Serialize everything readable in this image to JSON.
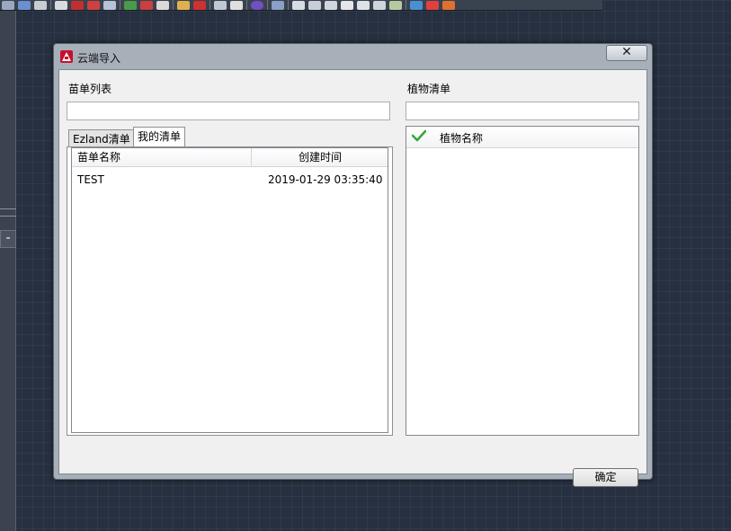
{
  "dialog": {
    "title": "云端导入",
    "close_label": "✕"
  },
  "left": {
    "section_label": "苗单列表",
    "search_value": "",
    "tabs": [
      {
        "label": "Ezland清单",
        "active": false
      },
      {
        "label": "我的清单",
        "active": true
      }
    ],
    "columns": [
      "苗单名称",
      "创建时间"
    ],
    "rows": [
      {
        "name": "TEST",
        "created": "2019-01-29 03:35:40"
      }
    ]
  },
  "right": {
    "section_label": "植物清单",
    "search_value": "",
    "columns": [
      "植物名称"
    ],
    "header_check_icon": "checkmark-icon"
  },
  "footer": {
    "ok_label": "确定"
  },
  "colors": {
    "cad_background": "#263040",
    "app_icon_red": "#c8102e",
    "check_green": "#3aa53a"
  }
}
